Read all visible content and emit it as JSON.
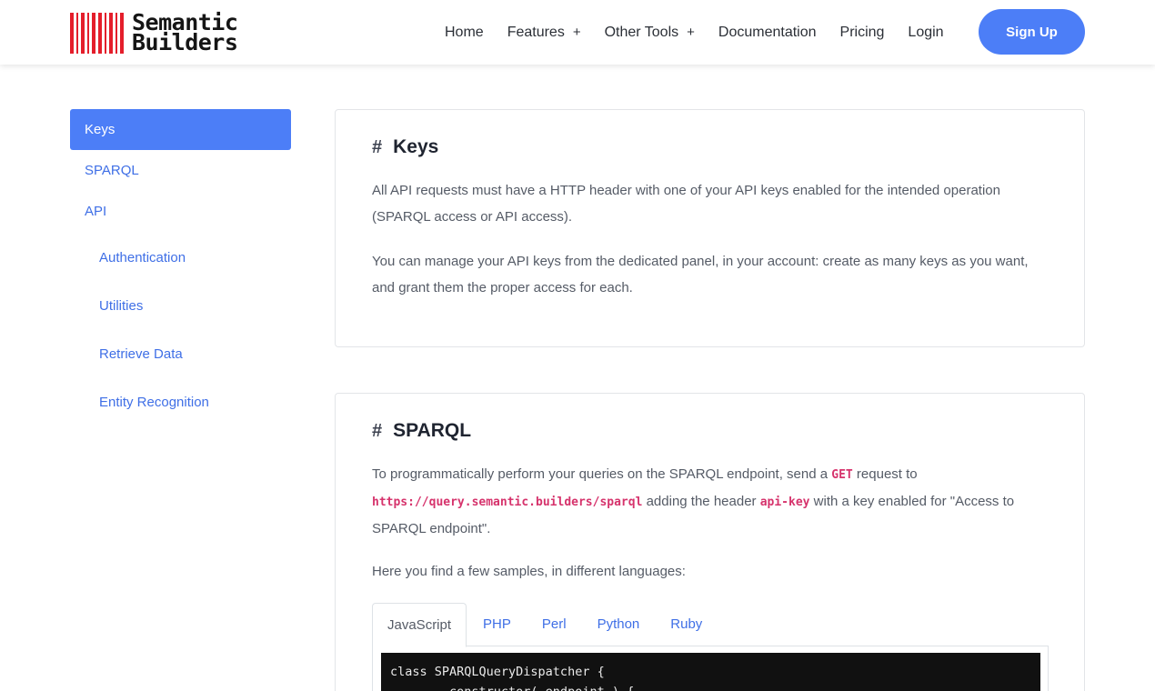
{
  "header": {
    "logo_line1": "Semantic",
    "logo_line2": "Builders",
    "nav": [
      {
        "label": "Home",
        "expandable": false
      },
      {
        "label": "Features",
        "expandable": true
      },
      {
        "label": "Other Tools",
        "expandable": true
      },
      {
        "label": "Documentation",
        "expandable": false
      },
      {
        "label": "Pricing",
        "expandable": false
      },
      {
        "label": "Login",
        "expandable": false
      }
    ],
    "expand_glyph": "+",
    "signup_label": "Sign Up"
  },
  "sidebar": {
    "items": [
      {
        "label": "Keys",
        "active": true
      },
      {
        "label": "SPARQL",
        "active": false
      },
      {
        "label": "API",
        "active": false
      }
    ],
    "subitems": [
      "Authentication",
      "Utilities",
      "Retrieve Data",
      "Entity Recognition"
    ]
  },
  "sections": {
    "keys": {
      "hash": "#",
      "title": "Keys",
      "p1": "All API requests must have a HTTP header with one of your API keys enabled for the intended operation (SPARQL access or API access).",
      "p2": "You can manage your API keys from the dedicated panel, in your account: create as many keys as you want, and grant them the proper access for each."
    },
    "sparql": {
      "hash": "#",
      "title": "SPARQL",
      "p1_a": "To programmatically perform your queries on the SPARQL endpoint, send a ",
      "p1_code1": "GET",
      "p1_b": " request to ",
      "p1_code2": "https://query.semantic.builders/sparql",
      "p1_c": " adding the header ",
      "p1_code3": "api-key",
      "p1_d": " with a key enabled for \"Access to SPARQL endpoint\".",
      "p2": "Here you find a few samples, in different languages:",
      "tabs": [
        {
          "label": "JavaScript",
          "active": true
        },
        {
          "label": "PHP",
          "active": false
        },
        {
          "label": "Perl",
          "active": false
        },
        {
          "label": "Python",
          "active": false
        },
        {
          "label": "Ruby",
          "active": false
        }
      ],
      "code": "class SPARQLQueryDispatcher {\n        constructor( endpoint ) {"
    }
  },
  "colors": {
    "accent": "#4c7ef7",
    "link": "#3f6fe6",
    "logo_red": "#e41e2b",
    "inline_code": "#d6336c"
  }
}
